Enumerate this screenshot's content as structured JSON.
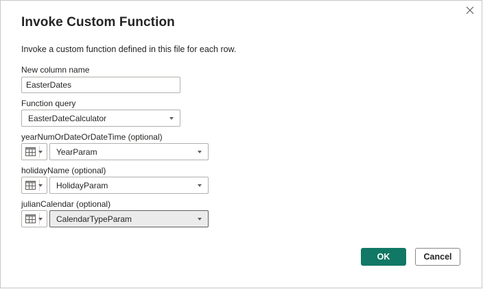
{
  "dialog": {
    "title": "Invoke Custom Function",
    "subtitle": "Invoke a custom function defined in this file for each row.",
    "close_icon": "close-icon"
  },
  "new_column": {
    "label": "New column name",
    "value": "EasterDates"
  },
  "function_query": {
    "label": "Function query",
    "value": "EasterDateCalculator"
  },
  "parameters": [
    {
      "label": "yearNumOrDateOrDateTime (optional)",
      "type_icon": "table-icon",
      "value": "YearParam"
    },
    {
      "label": "holidayName (optional)",
      "type_icon": "table-icon",
      "value": "HolidayParam"
    },
    {
      "label": "julianCalendar (optional)",
      "type_icon": "table-icon",
      "value": "CalendarTypeParam"
    }
  ],
  "buttons": {
    "ok_label": "OK",
    "cancel_label": "Cancel"
  },
  "colors": {
    "primary": "#117865",
    "border": "#b3b0ad",
    "text": "#252423"
  }
}
